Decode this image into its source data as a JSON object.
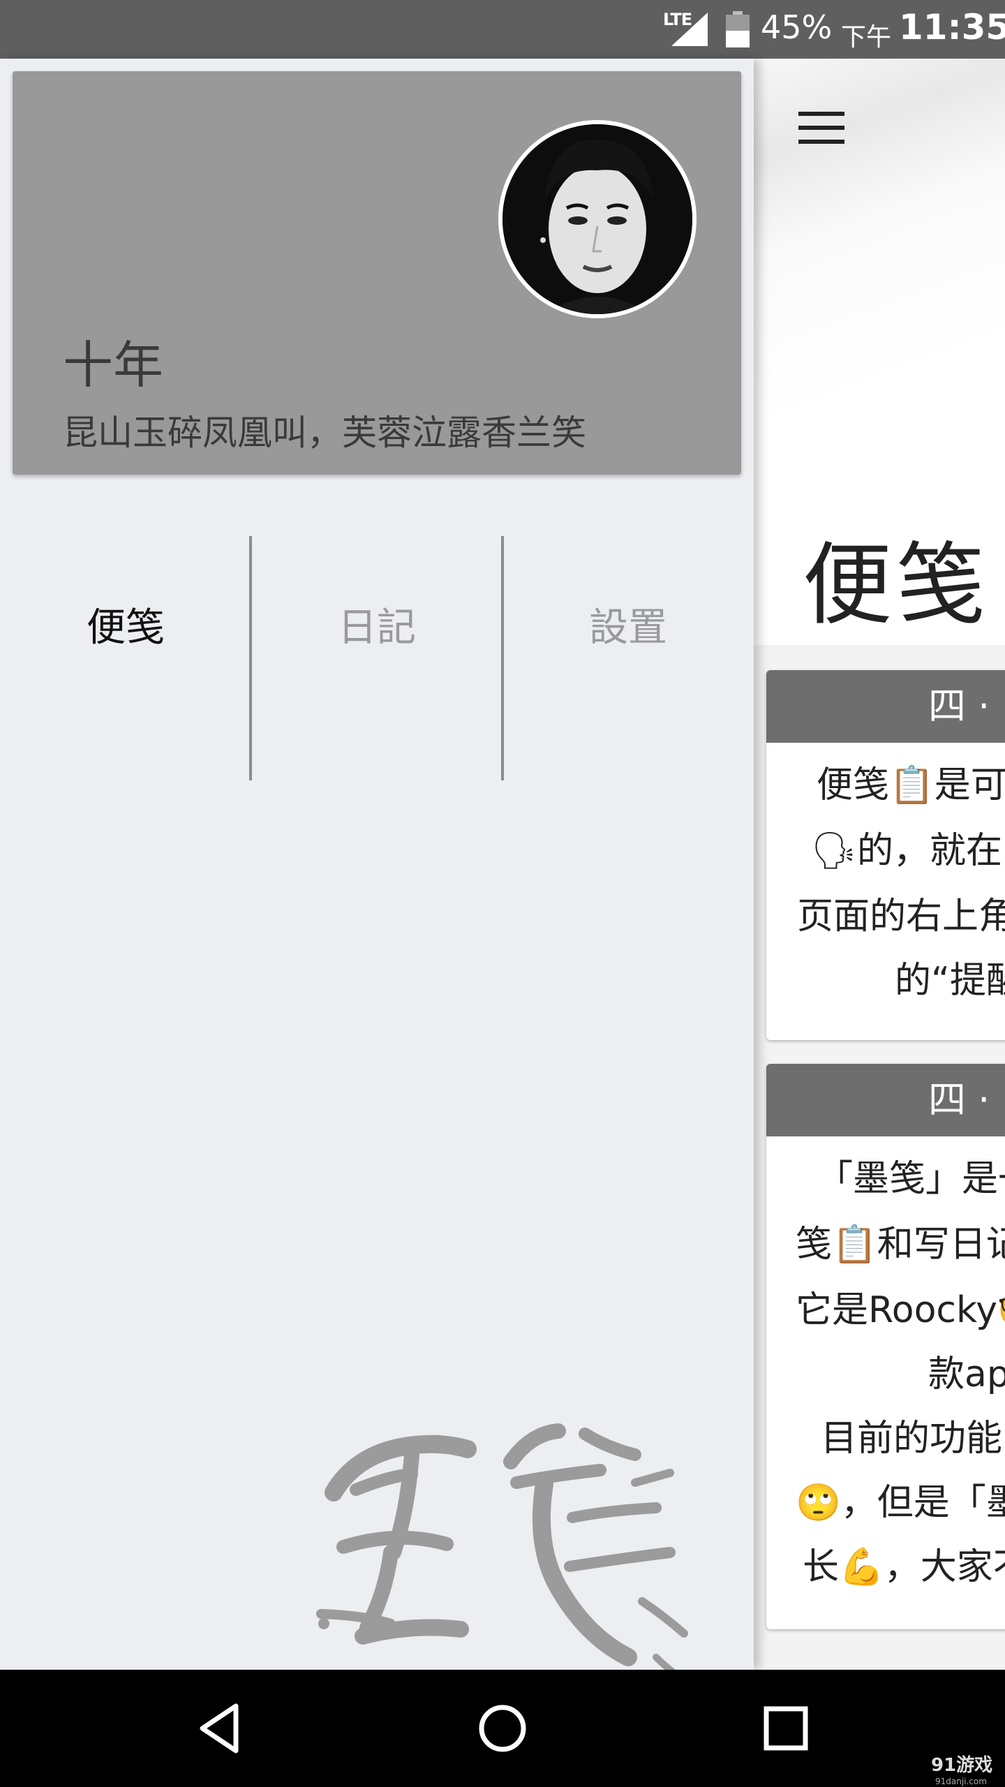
{
  "status_bar": {
    "network": "LTE",
    "battery": "45%",
    "ampm": "下午",
    "time": "11:35"
  },
  "main": {
    "title": "便笺",
    "cards": [
      {
        "header": "四 · ",
        "lines": [
          "便笺📋是可",
          "🗣的，就在",
          "页面的右上角",
          "的“提醒"
        ]
      },
      {
        "header": "四 · ",
        "lines": [
          "「墨笺」是一",
          "笺📋和写日记",
          "它是Roocky🤓",
          "款ap",
          "目前的功能",
          "🙄，但是「墨",
          "长💪，大家不"
        ]
      }
    ]
  },
  "drawer": {
    "profile": {
      "name": "十年",
      "motto": "昆山玉碎凤凰叫，芙蓉泣露香兰笑"
    },
    "tabs": [
      {
        "label": "便笺",
        "active": true
      },
      {
        "label": "日記",
        "active": false
      },
      {
        "label": "設置",
        "active": false
      }
    ],
    "watermark_text": "墨笺"
  },
  "nav_bar": {
    "buttons": [
      "back",
      "home",
      "recents"
    ],
    "site_mark": "91游戏",
    "site_url": "91danji.com"
  }
}
